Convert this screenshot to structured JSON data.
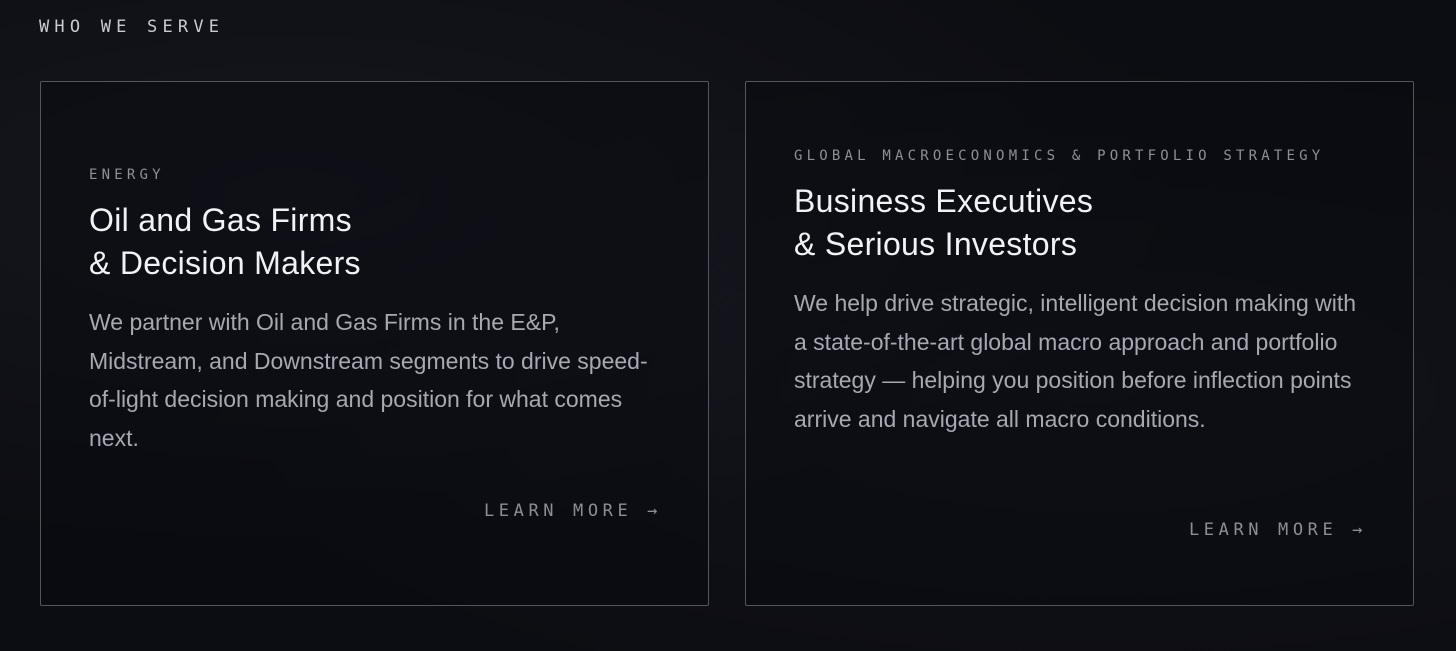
{
  "section": {
    "label": "WHO WE SERVE"
  },
  "cards": [
    {
      "eyebrow": "ENERGY",
      "title_line1": "Oil and Gas Firms",
      "title_line2": "& Decision Makers",
      "description": "We partner with Oil and Gas Firms in the E&P, Midstream, and Downstream segments to drive speed-of-light decision making and position for what comes next.",
      "cta": "LEARN MORE →"
    },
    {
      "eyebrow": "GLOBAL MACROECONOMICS & PORTFOLIO STRATEGY",
      "title_line1": "Business Executives",
      "title_line2": "& Serious Investors",
      "description": "We help drive strategic, intelligent decision making with a state-of-the-art global macro approach and portfolio strategy — helping you position before inflection points arrive and navigate all macro conditions.",
      "cta": "LEARN MORE →"
    }
  ],
  "colors": {
    "background": "#0c0d12",
    "card_border": "#54565d",
    "title": "#f1f2f5",
    "body_text": "#a7a9b1",
    "muted": "#8e9099"
  }
}
